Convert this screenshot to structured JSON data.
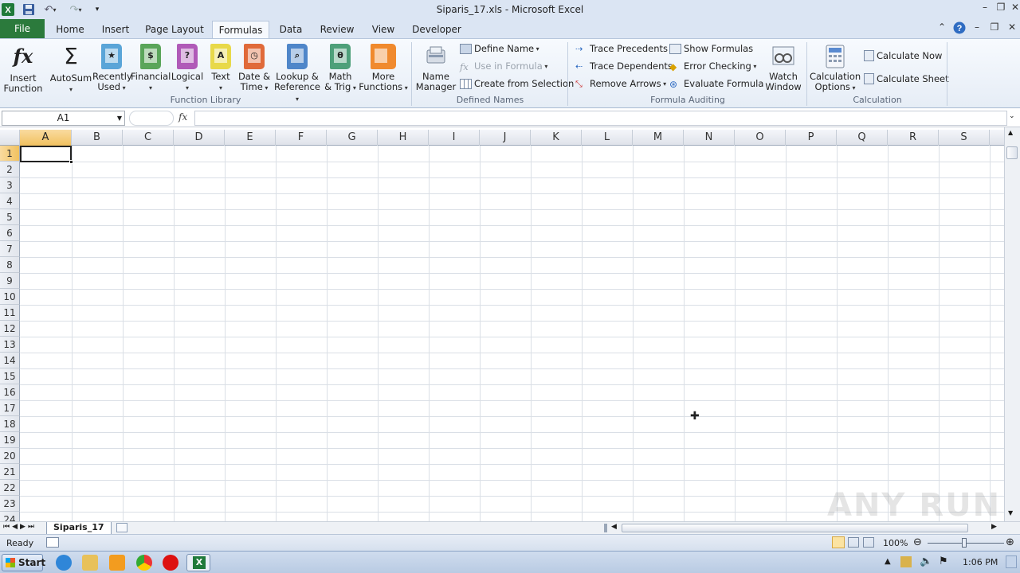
{
  "window": {
    "title": "Siparis_17.xls - Microsoft Excel"
  },
  "tabs": [
    "File",
    "Home",
    "Insert",
    "Page Layout",
    "Formulas",
    "Data",
    "Review",
    "View",
    "Developer"
  ],
  "ribbon": {
    "function_library": {
      "label": "Function Library",
      "insert_function": [
        "Insert",
        "Function"
      ],
      "autosum": "AutoSum",
      "recently_used": [
        "Recently",
        "Used"
      ],
      "financial": "Financial",
      "logical": "Logical",
      "text": "Text",
      "date_time": [
        "Date &",
        "Time"
      ],
      "lookup": [
        "Lookup &",
        "Reference"
      ],
      "math": [
        "Math",
        "& Trig"
      ],
      "more": [
        "More",
        "Functions"
      ]
    },
    "defined_names": {
      "label": "Defined Names",
      "name_manager": [
        "Name",
        "Manager"
      ],
      "define_name": "Define Name",
      "use_in_formula": "Use in Formula",
      "create_from_selection": "Create from Selection"
    },
    "formula_auditing": {
      "label": "Formula Auditing",
      "trace_precedents": "Trace Precedents",
      "trace_dependents": "Trace Dependents",
      "remove_arrows": "Remove Arrows",
      "show_formulas": "Show Formulas",
      "error_checking": "Error Checking",
      "evaluate_formula": "Evaluate Formula",
      "watch_window": [
        "Watch",
        "Window"
      ]
    },
    "calculation": {
      "label": "Calculation",
      "options": [
        "Calculation",
        "Options"
      ],
      "calculate_now": "Calculate Now",
      "calculate_sheet": "Calculate Sheet"
    }
  },
  "formula_bar": {
    "name_box": "A1",
    "fx": "fx",
    "formula": ""
  },
  "grid": {
    "columns": [
      "A",
      "B",
      "C",
      "D",
      "E",
      "F",
      "G",
      "H",
      "I",
      "J",
      "K",
      "L",
      "M",
      "N",
      "O",
      "P",
      "Q",
      "R",
      "S"
    ],
    "rows": [
      "1",
      "2",
      "3",
      "4",
      "5",
      "6",
      "7",
      "8",
      "9",
      "10",
      "11",
      "12",
      "13",
      "14",
      "15",
      "16",
      "17",
      "18",
      "19",
      "20",
      "21",
      "22",
      "23",
      "24"
    ],
    "selected_cell": "A1"
  },
  "sheet_tab": "Siparis_17",
  "status": {
    "ready": "Ready",
    "zoom": "100%"
  },
  "taskbar": {
    "start": "Start",
    "clock": "1:06 PM"
  },
  "watermark": "ANY RUN"
}
